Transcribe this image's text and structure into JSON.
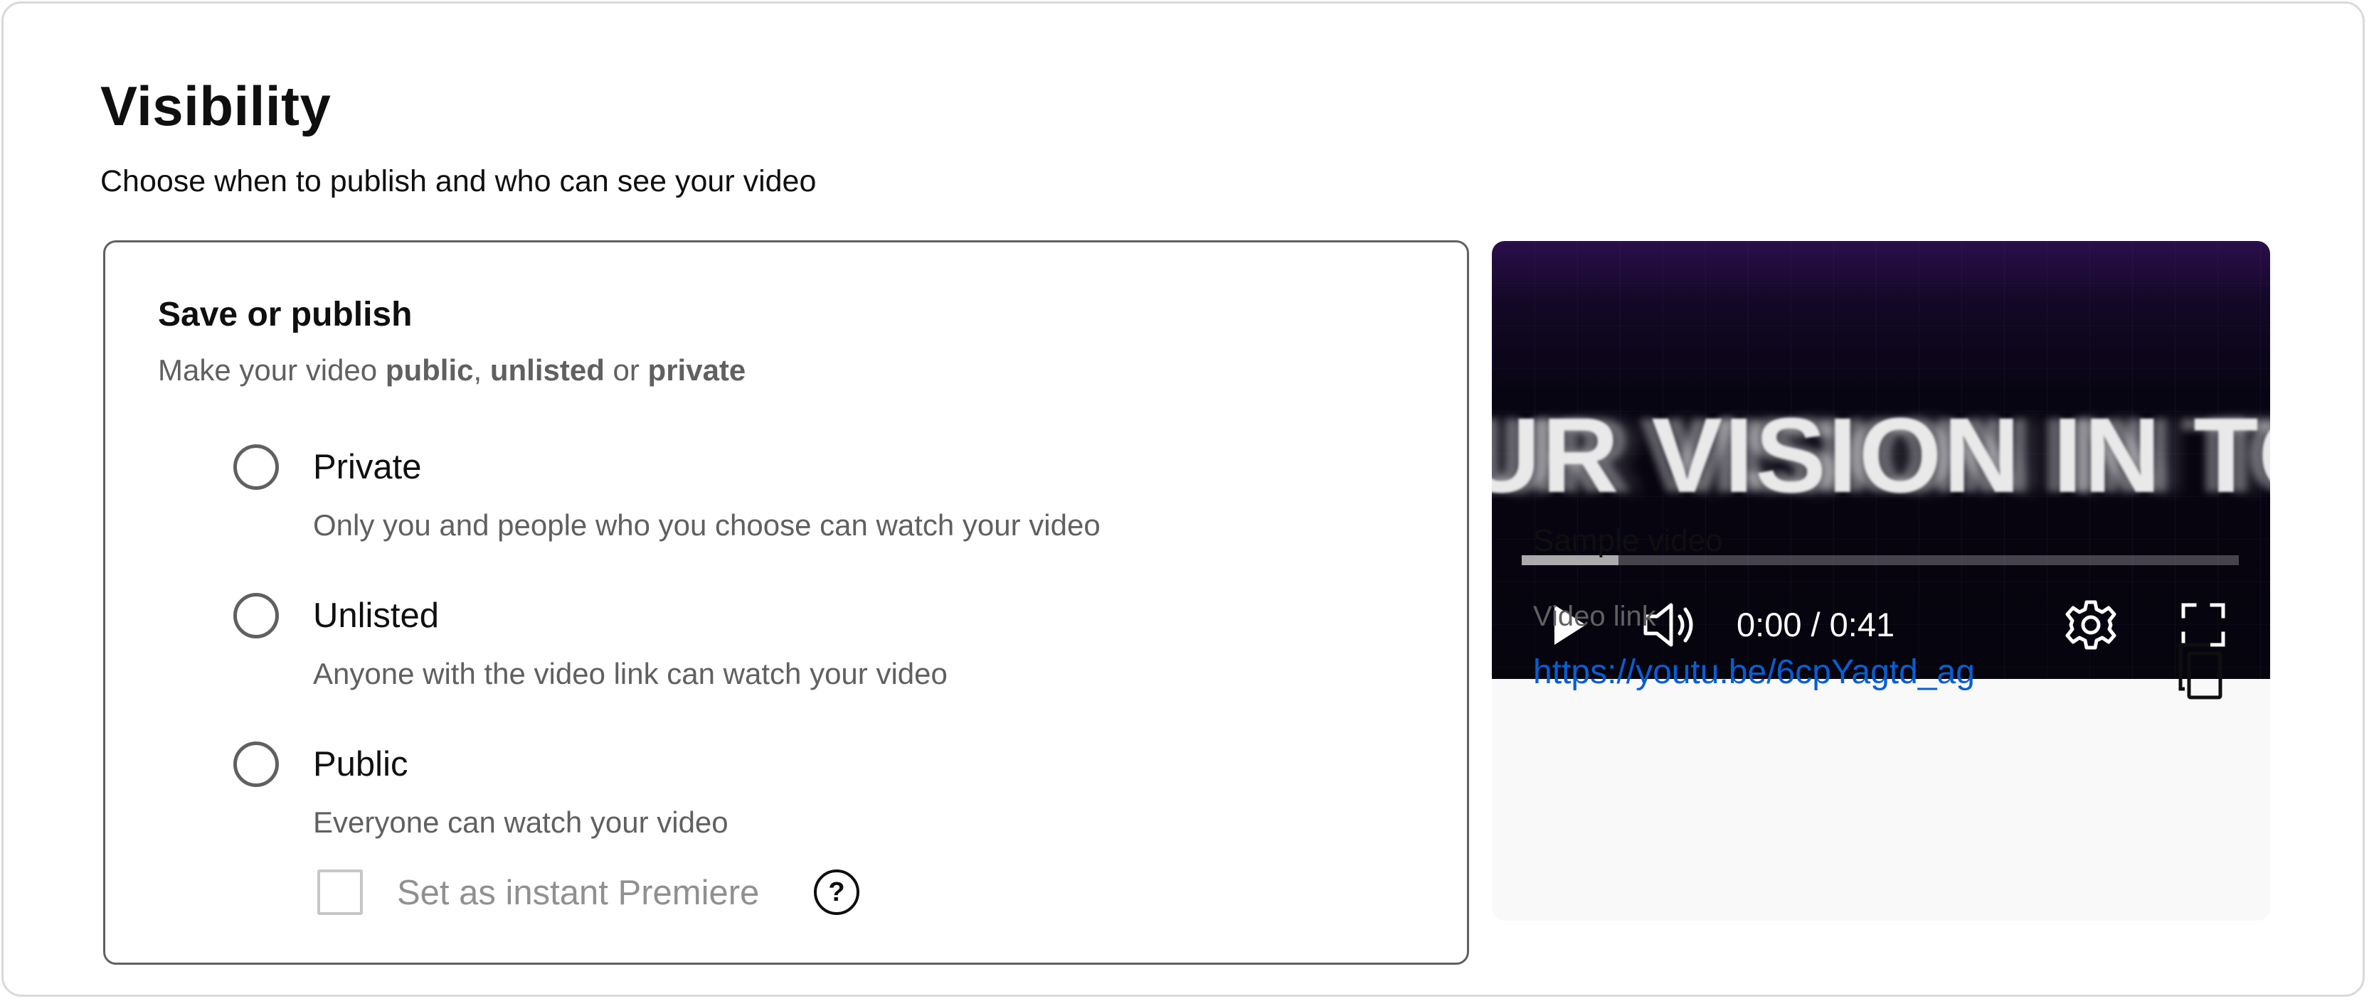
{
  "header": {
    "title": "Visibility",
    "subtitle": "Choose when to publish and who can see your video"
  },
  "publish_card": {
    "title": "Save or publish",
    "subtitle_prefix": "Make your video ",
    "subtitle_public": "public",
    "subtitle_sep1": ", ",
    "subtitle_unlisted": "unlisted",
    "subtitle_sep2": " or ",
    "subtitle_private": "private",
    "options": [
      {
        "label": "Private",
        "description": "Only you and people who you choose can watch your video",
        "selected": false
      },
      {
        "label": "Unlisted",
        "description": "Anyone with the video link can watch your video",
        "selected": false
      },
      {
        "label": "Public",
        "description": "Everyone can watch your video",
        "selected": false
      }
    ],
    "premiere": {
      "label": "Set as instant Premiere",
      "checked": false,
      "enabled": false,
      "help_icon": "?"
    }
  },
  "preview": {
    "frame_text": "UR VISION IN TO",
    "progress_buffered": 0.135,
    "time_display": "0:00 / 0:41",
    "controls": [
      "play-icon",
      "volume-icon",
      "settings-gear-icon",
      "fullscreen-icon"
    ],
    "video_name": "Sample video",
    "link_label": "Video link",
    "link_url": "https://youtu.be/6cpYagtd_ag",
    "copy_icon": "copy-icon"
  },
  "colors": {
    "text_primary": "#0f0f0f",
    "text_secondary": "#606060",
    "link": "#065fd4",
    "disabled": "#909090",
    "card_border": "#606060",
    "info_background": "#f9f9f9"
  }
}
